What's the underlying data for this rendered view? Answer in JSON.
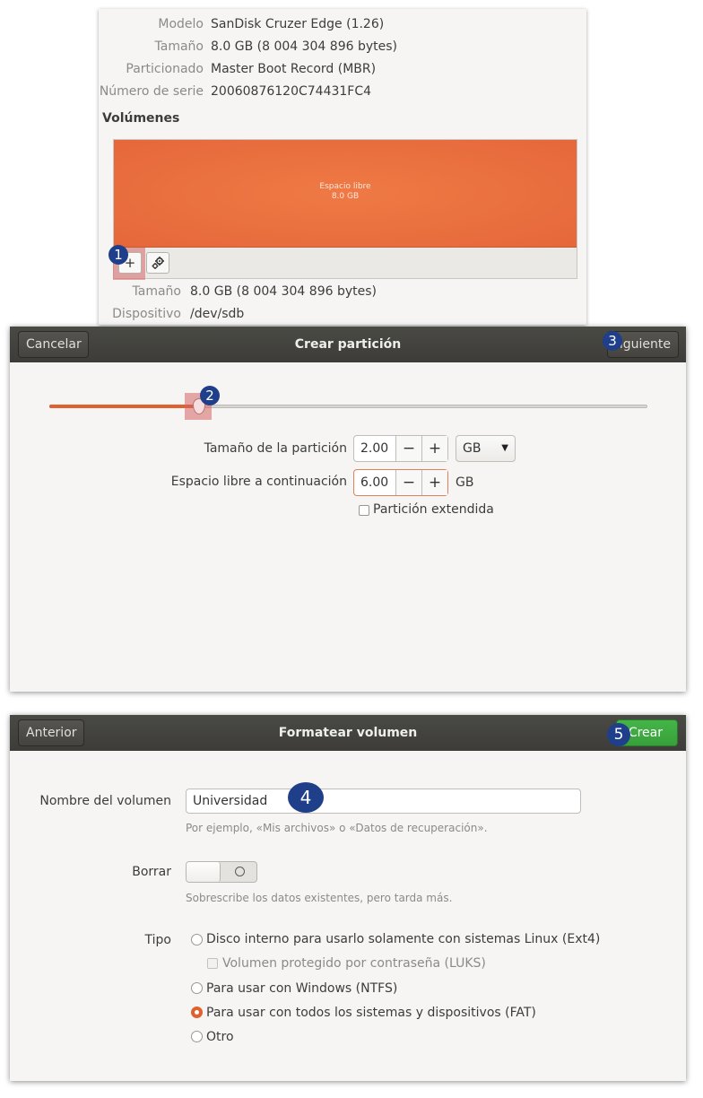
{
  "disk_info": {
    "rows": [
      {
        "key": "Modelo",
        "value": "SanDisk Cruzer Edge (1.26)"
      },
      {
        "key": "Tamaño",
        "value": "8.0 GB (8 004 304 896 bytes)"
      },
      {
        "key": "Particionado",
        "value": "Master Boot Record (MBR)"
      },
      {
        "key": "Número de serie",
        "value": "20060876120C74431FC4"
      }
    ],
    "volumes_title": "Volúmenes",
    "volume_bar": {
      "label": "Espacio libre",
      "size": "8.0 GB",
      "color": "#e5673a"
    },
    "add_button_glyph": "+",
    "settings_icon": "gears-icon",
    "detail_rows": [
      {
        "key": "Tamaño",
        "value": "8.0 GB (8 004 304 896 bytes)"
      },
      {
        "key": "Dispositivo",
        "value": "/dev/sdb"
      }
    ]
  },
  "create_partition": {
    "title": "Crear partición",
    "cancel_label": "Cancelar",
    "next_label": "Siguiente",
    "next_label_visible": "iguiente",
    "slider_fraction": 0.25,
    "size_label": "Tamaño de la partición",
    "size_value": "2.00",
    "size_unit": "GB",
    "free_label": "Espacio libre a continuación",
    "free_value": "6.00",
    "free_unit": "GB",
    "minus_glyph": "−",
    "plus_glyph": "+",
    "extended_label": "Partición extendida",
    "extended_checked": false
  },
  "format_volume": {
    "title": "Formatear volumen",
    "back_label": "Anterior",
    "create_label": "Crear",
    "create_label_visible": "Crear",
    "name_label": "Nombre del volumen",
    "name_value": "Universidad",
    "name_hint": "Por ejemplo, «Mis archivos» o «Datos de recuperación».",
    "erase_label": "Borrar",
    "erase_on": false,
    "erase_hint": "Sobrescribe los datos existentes, pero tarda más.",
    "type_label": "Tipo",
    "type_options": [
      {
        "label": "Disco interno para usarlo solamente con sistemas Linux (Ext4)",
        "checked": false
      },
      {
        "label": "Volumen protegido por contraseña (LUKS)",
        "checked": false,
        "sub_checkbox": true,
        "disabled": true
      },
      {
        "label": "Para usar con Windows (NTFS)",
        "checked": false
      },
      {
        "label": "Para usar con todos los sistemas y dispositivos (FAT)",
        "checked": true
      },
      {
        "label": "Otro",
        "checked": false
      }
    ],
    "accent_color": "#e0602f",
    "create_color": "#37a03a"
  },
  "step_badges": [
    "1",
    "2",
    "3",
    "4",
    "5"
  ]
}
